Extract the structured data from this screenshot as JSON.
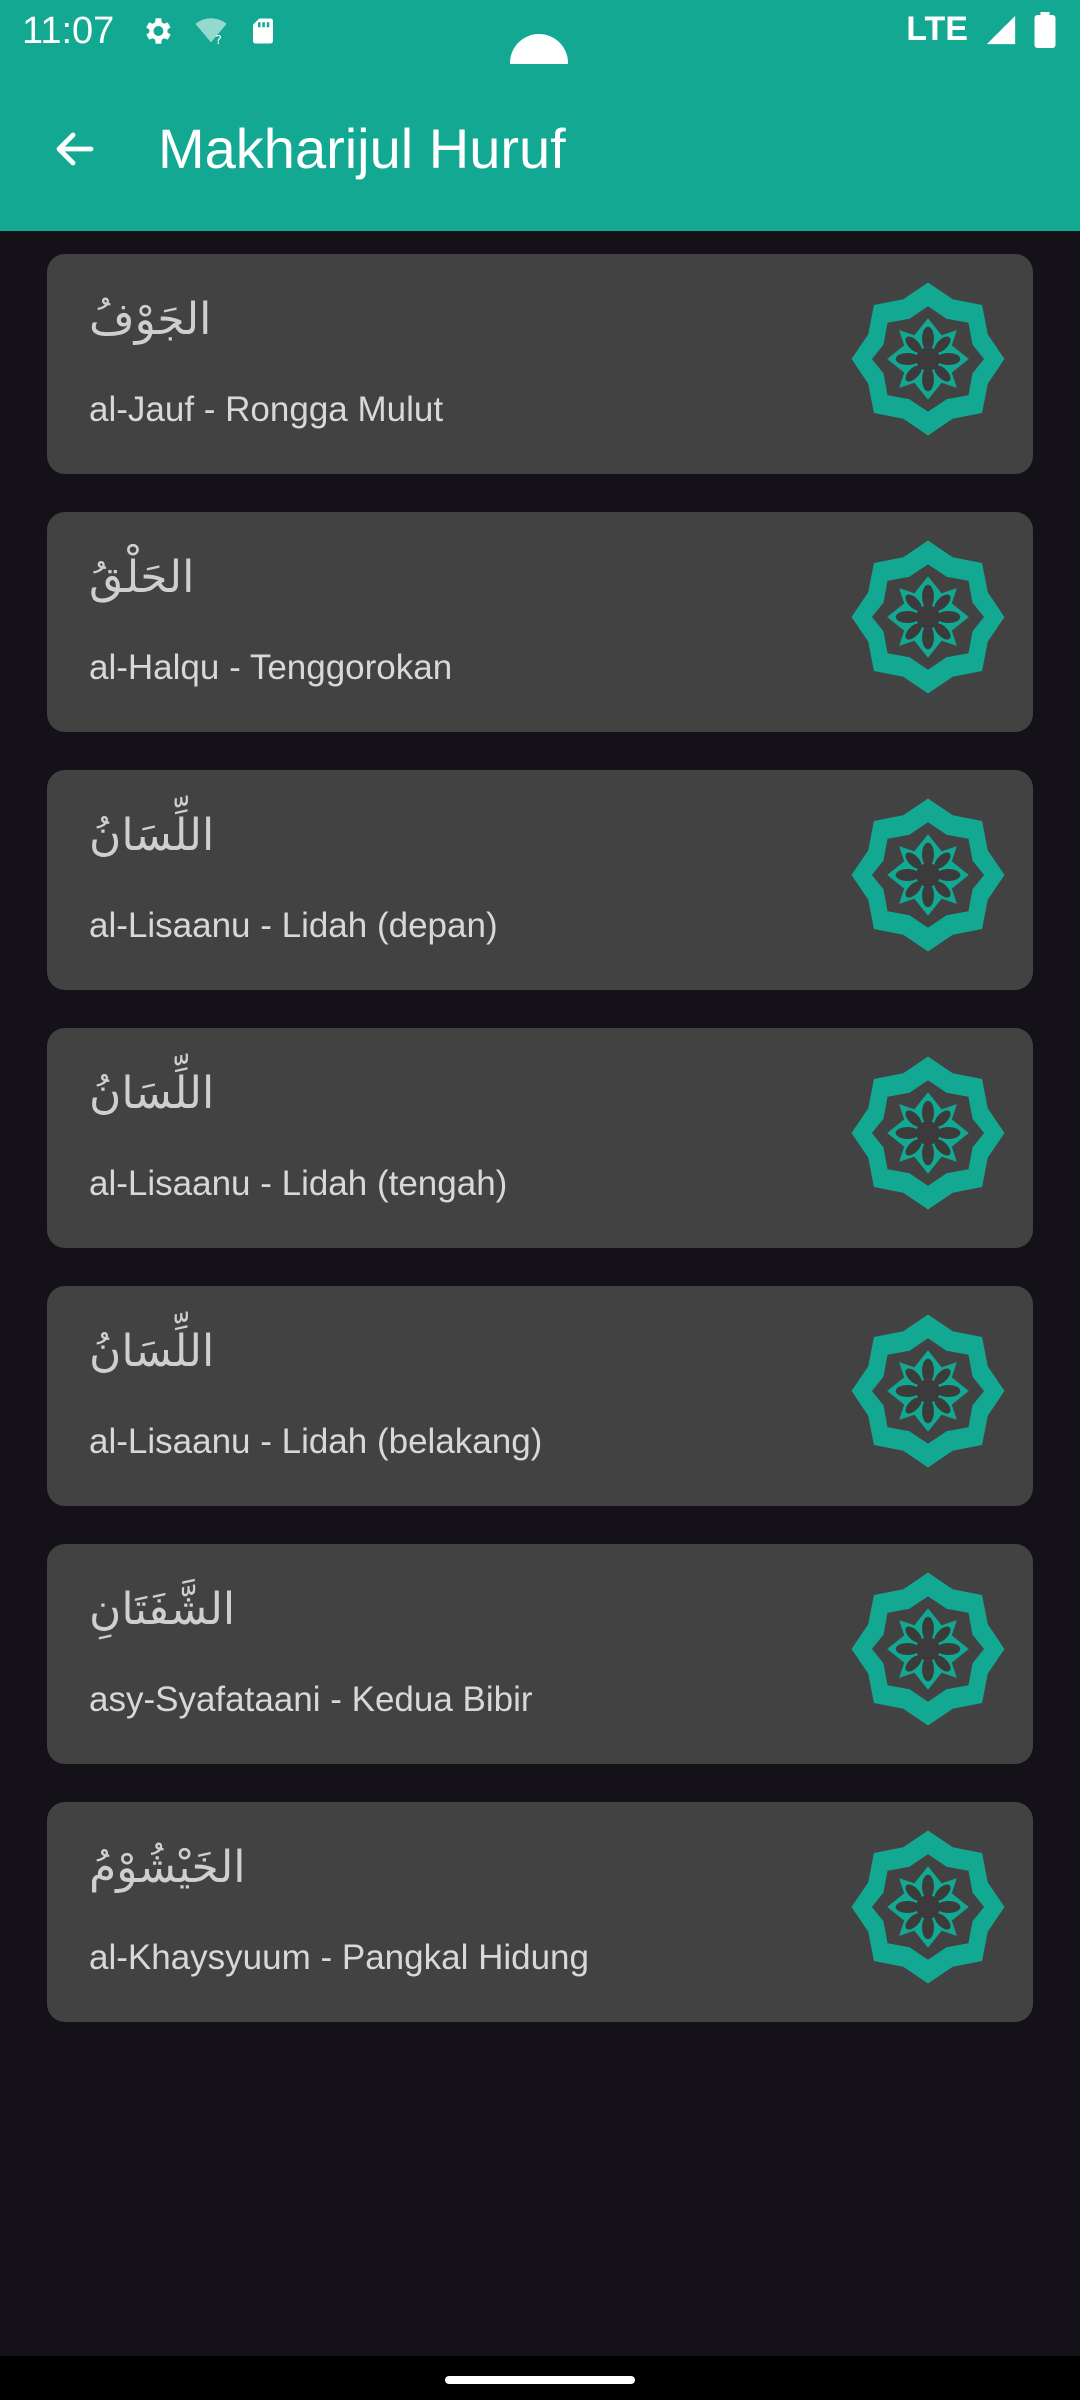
{
  "status_bar": {
    "time": "11:07",
    "network": "LTE",
    "icons": [
      "gear-icon",
      "wifi-unknown-icon",
      "sd-card-icon",
      "signal-icon",
      "battery-icon"
    ]
  },
  "app_bar": {
    "title": "Makharijul Huruf",
    "back_icon": "arrow-left-icon"
  },
  "items": [
    {
      "arabic": "الجَوْفُ",
      "label": "al-Jauf - Rongga Mulut"
    },
    {
      "arabic": "الحَلْقُ",
      "label": "al-Halqu - Tenggorokan"
    },
    {
      "arabic": "اللِّسَانُ",
      "label": "al-Lisaanu - Lidah (depan)"
    },
    {
      "arabic": "اللِّسَانُ",
      "label": "al-Lisaanu - Lidah (tengah)"
    },
    {
      "arabic": "اللِّسَانُ",
      "label": "al-Lisaanu - Lidah (belakang)"
    },
    {
      "arabic": "الشَّفَتَانِ",
      "label": "asy-Syafataani - Kedua Bibir"
    },
    {
      "arabic": "الخَيْشُوْمُ",
      "label": "al-Khaysyuum - Pangkal Hidung"
    }
  ],
  "colors": {
    "accent": "#12a892",
    "card": "#424242",
    "background": "#141218",
    "text": "#d8d8d8"
  }
}
